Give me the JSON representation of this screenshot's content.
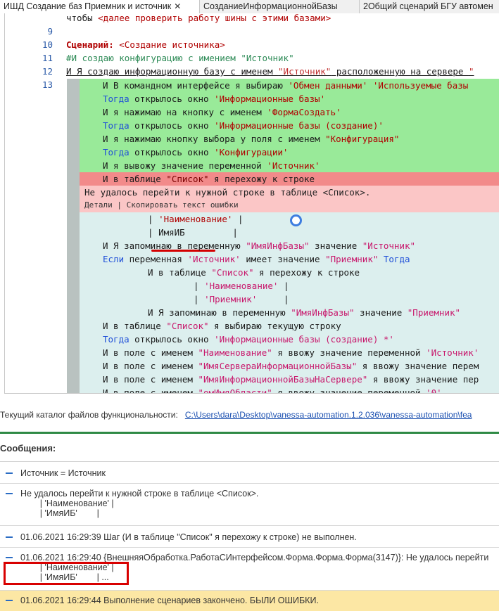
{
  "tabs": [
    {
      "label": "ИШД Создание баз Приемник и источник",
      "close": "✕"
    },
    {
      "label": "СозданиеИнформационнойБазы"
    },
    {
      "label": "2Общий сценарий БГУ автомен"
    }
  ],
  "editor": {
    "top_line": {
      "text_a": "чтобы ",
      "text_b": "<далее проверить работу шины с этими базами>"
    },
    "line_numbers": [
      "9",
      "10",
      "11",
      "12",
      "13"
    ],
    "line11": {
      "kw": "Сценарий: ",
      "rest": "<Создание источника>"
    },
    "line12": "#И создаю конфигурацию с имением \"Источник\"",
    "line13": {
      "a": "И Я создаю информационную базу с именем ",
      "b": "\"Источник\"",
      "c": " расположенную на сервере ",
      "d": "\""
    },
    "sub_lines": {
      "s1": {
        "a": "И В командном интерфейсе я выбираю ",
        "b": "'Обмен данными'",
        "c": " ",
        "d": "'Используемые базы"
      },
      "s2": {
        "a": "Тогда",
        "b": " открылось окно ",
        "c": "'Информационные базы'"
      },
      "s3": {
        "a": "И я нажимаю на кнопку с именем ",
        "b": "'ФормаСоздать'"
      },
      "s4": {
        "a": "Тогда",
        "b": " открылось окно ",
        "c": "'Информационные базы (создание)'"
      },
      "s5": {
        "a": "И я нажимаю кнопку выбора у поля с именем ",
        "b": "\"Конфигурация\""
      },
      "s6": {
        "a": "Тогда",
        "b": " открылось окно ",
        "c": "'Конфигурации'"
      },
      "s7": {
        "a": "И я вывожу значение переменной ",
        "b": "'Источник'"
      },
      "s8": {
        "a": "И в таблице ",
        "b": "\"Список\"",
        "c": " я перехожу к строке"
      },
      "err": "Не удалось перейти к нужной строке в таблице <Список>.",
      "err_details": "Детали",
      "err_sep": " | ",
      "err_copy": "Скопировать текст ошибки",
      "t1": {
        "a": "| ",
        "b": "'Наименование'",
        "c": " |"
      },
      "t2": {
        "a": "| ",
        "b": "ИмяИБ",
        "c": "         |"
      },
      "s9": {
        "a": "И Я запоминаю в переменную ",
        "b": "\"ИмяИнфБазы\"",
        "c": " значение ",
        "d": "\"Источник\""
      },
      "s10": {
        "a": "Если",
        "b": " переменная ",
        "c": "'Источник'",
        "d": " имеет значение ",
        "e": "\"Приемник\"",
        "f": " Тогда"
      },
      "s11": {
        "a": "И в таблице ",
        "b": "\"Список\"",
        "c": " я перехожу к строке"
      },
      "t3": {
        "a": "| ",
        "b": "'Наименование'",
        "c": " |"
      },
      "t4": {
        "a": "| ",
        "b": "'Приемник'",
        "c": "     |"
      },
      "s12": {
        "a": "И Я запоминаю в переменную ",
        "b": "\"ИмяИнфБазы\"",
        "c": " значение ",
        "d": "\"Приемник\""
      },
      "s13": {
        "a": "И в таблице ",
        "b": "\"Список\"",
        "c": " я выбираю текущую строку"
      },
      "s14": {
        "a": "Тогда",
        "b": " открылось окно ",
        "c": "'Информационные базы (создание) *'"
      },
      "s15": {
        "a": "И в поле с именем ",
        "b": "\"Наименование\"",
        "c": " я ввожу значение переменной ",
        "d": "'Источник'"
      },
      "s16": {
        "a": "И в поле с именем ",
        "b": "\"ИмяСервераИнформационнойБазы\"",
        "c": " я ввожу значение перем"
      },
      "s17": {
        "a": "И в поле с именем ",
        "b": "\"ИмяИнформационнойБазыНаСервере\"",
        "c": " я ввожу значение пер"
      },
      "s18": {
        "a": "И в поле с именем ",
        "b": "\"омИмяОбласти\"",
        "c": " я ввожу значение переменной ",
        "d": "'0'"
      }
    }
  },
  "path_row": {
    "label": "Текущий каталог файлов функциональности:",
    "link": "C:\\Users\\dara\\Desktop\\vanessa-automation.1.2.036\\vanessa-automation\\fea"
  },
  "messages": {
    "title": "Сообщения:",
    "items": [
      "Источник = Источник",
      "Не удалось перейти к нужной строке в таблице <Список>.\n        | 'Наименование' |\n        | 'ИмяИБ'        |",
      "01.06.2021 16:29:39 Шаг (И в таблице \"Список\" я перехожу к строке) не выполнен.",
      "01.06.2021 16:29:40 {ВнешняяОбработка.РаботаСИнтерфейсом.Форма.Форма.Форма(3147)}: Не удалось перейти\n        | 'Наименование' |\n        | 'ИмяИБ'        | ...",
      "01.06.2021 16:29:44 Выполнение сценариев закончено. БЫЛИ ОШИБКИ."
    ]
  },
  "colors": {
    "passed_step": "#99ea99",
    "failed_step": "#f28a8a",
    "error_block": "#fbc6c6",
    "final_message": "#fce7a4",
    "annotation_red": "#d80000"
  }
}
